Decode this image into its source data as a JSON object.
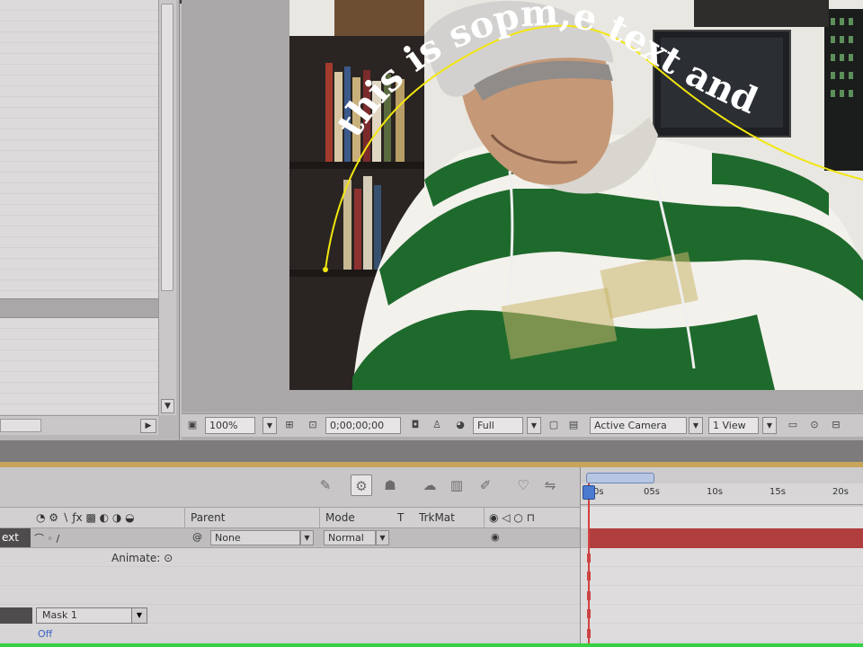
{
  "composition": {
    "path_text": "this is sopm,e text and",
    "toolbar": {
      "zoom": "100%",
      "timecode": "0;00;00;00",
      "resolution": "Full",
      "camera": "Active Camera",
      "views": "1 View"
    }
  },
  "timeline": {
    "columns": {
      "parent": "Parent",
      "mode": "Mode",
      "t": "T",
      "trkmat": "TrkMat"
    },
    "layer": {
      "name_fragment": "ext",
      "parent_value": "None",
      "mode_value": "Normal"
    },
    "animate_label": "Animate:",
    "mask": {
      "name": "Mask 1",
      "value": "Off"
    },
    "ruler": [
      "0s",
      "05s",
      "10s",
      "15s",
      "20s"
    ]
  },
  "colors": {
    "layer_bar": "#b13e3e",
    "mask_path": "#f2e60f",
    "accent_blue": "#4a7bd0"
  }
}
